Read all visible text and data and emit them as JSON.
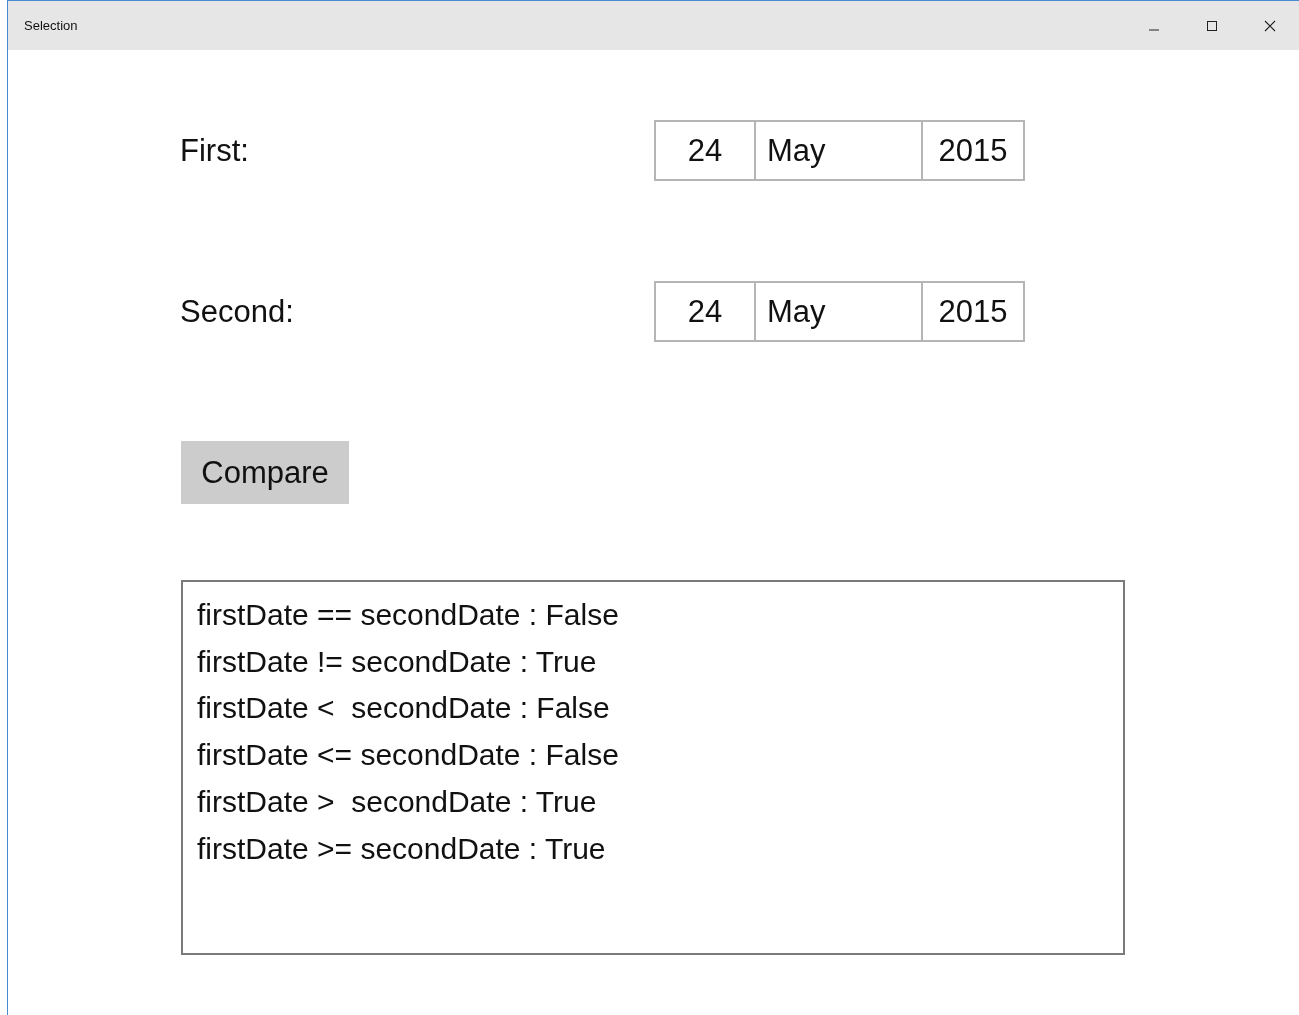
{
  "window": {
    "title": "Selection"
  },
  "dates": [
    {
      "label": "First:",
      "day": "24",
      "month": "May",
      "year": "2015"
    },
    {
      "label": "Second:",
      "day": "24",
      "month": "May",
      "year": "2015"
    }
  ],
  "compare_button": {
    "label": "Compare"
  },
  "output_lines": [
    "firstDate == secondDate : False",
    "firstDate != secondDate : True",
    "firstDate <  secondDate : False",
    "firstDate <= secondDate : False",
    "firstDate >  secondDate : True",
    "firstDate >= secondDate : True"
  ]
}
